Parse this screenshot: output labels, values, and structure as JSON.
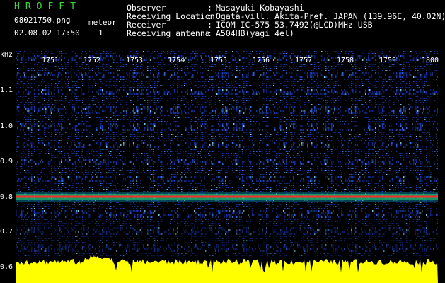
{
  "header": {
    "brand": "HROFFT",
    "filename": "08021750.png",
    "datetime": "02.08.02 17:50",
    "meteor_label": "meteor",
    "meteor_count": "1",
    "info": [
      {
        "label": "Observer",
        "value": "Masayuki Kobayashi"
      },
      {
        "label": "Receiving Location",
        "value": "Ogata-vill. Akita-Pref. JAPAN (139.96E, 40.02N)"
      },
      {
        "label": "Receiver",
        "value": "ICOM IC-575 53.7492(@LCD)MHz USB"
      },
      {
        "label": "Receiving antenna",
        "value": "A504HB(yagi 4el)"
      }
    ],
    "separator": ":"
  },
  "axis": {
    "unit": "kHz",
    "y_ticks": [
      "1.1",
      "1.0",
      "0.9",
      "0.8",
      "0.7",
      "0.6"
    ],
    "time_ticks": [
      "1751",
      "1752",
      "1753",
      "1754",
      "1755",
      "1756",
      "1757",
      "1758",
      "1759",
      "1800"
    ]
  },
  "colors": {
    "background": "#000000",
    "brand": "#39d83a",
    "noise_blue": "#1a3fd0",
    "carrier": "#ff2a2a",
    "signal_yellow": "#ffff00"
  }
}
